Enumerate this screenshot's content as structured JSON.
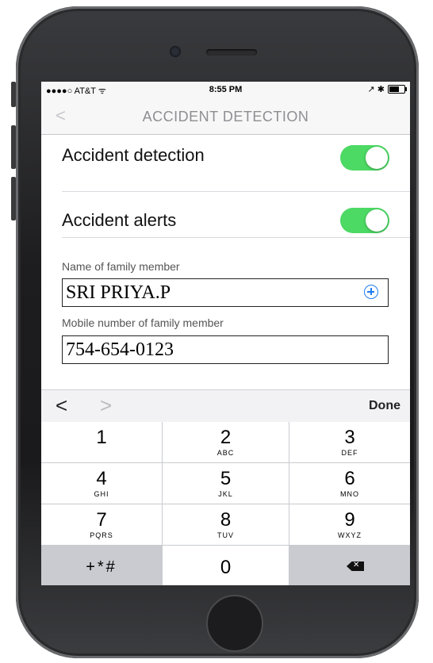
{
  "status_bar": {
    "carrier": "●●●●○ AT&T ᯤ",
    "time": "8:55 PM",
    "right_icons": "↗ ✱"
  },
  "nav": {
    "back": "<",
    "title": "ACCIDENT DETECTION"
  },
  "settings": [
    {
      "label": "Accident detection",
      "on": true
    },
    {
      "label": "Accident alerts",
      "on": true
    }
  ],
  "form": {
    "name_label": "Name of family member",
    "name_value": "SRI PRIYA.P",
    "mobile_label": "Mobile number of family member",
    "mobile_value": "754-654-0123"
  },
  "accessory": {
    "prev": "<",
    "next": ">",
    "done": "Done"
  },
  "keypad": [
    {
      "digit": "1",
      "letters": ""
    },
    {
      "digit": "2",
      "letters": "ABC"
    },
    {
      "digit": "3",
      "letters": "DEF"
    },
    {
      "digit": "4",
      "letters": "GHI"
    },
    {
      "digit": "5",
      "letters": "JKL"
    },
    {
      "digit": "6",
      "letters": "MNO"
    },
    {
      "digit": "7",
      "letters": "PQRS"
    },
    {
      "digit": "8",
      "letters": "TUV"
    },
    {
      "digit": "9",
      "letters": "WXYZ"
    },
    {
      "digit": "+*#",
      "letters": ""
    },
    {
      "digit": "0",
      "letters": ""
    }
  ],
  "colors": {
    "toggle_on": "#4cd964",
    "add_contact": "#1e7cf0"
  }
}
